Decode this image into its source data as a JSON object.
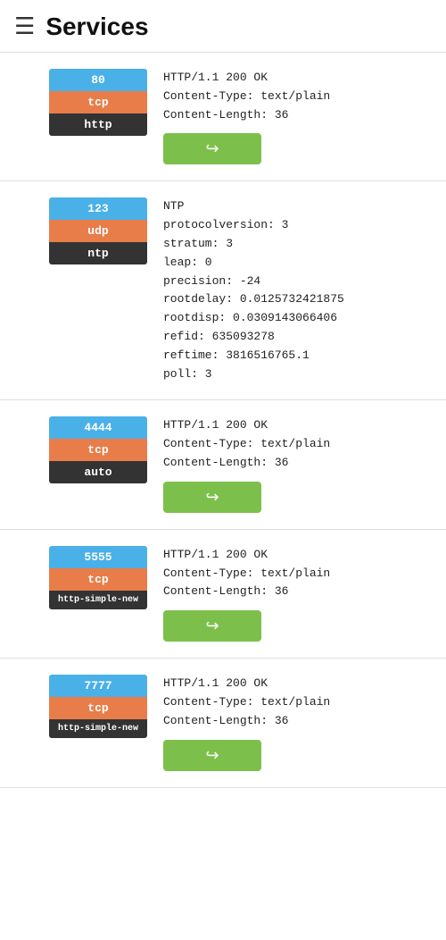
{
  "header": {
    "title": "Services",
    "icon": "☰"
  },
  "services": [
    {
      "id": "svc-80",
      "port": "80",
      "protocol": "tcp",
      "service": "http",
      "info": "HTTP/1.1 200 OK\nContent-Type: text/plain\nContent-Length: 36",
      "hasRedirect": true,
      "redirectLabel": "↪"
    },
    {
      "id": "svc-123",
      "port": "123",
      "protocol": "udp",
      "service": "ntp",
      "info": "NTP\nprotocolversion: 3\nstratum: 3\nleap: 0\nprecision: -24\nrootdelay: 0.0125732421875\nrootdisp: 0.0309143066406\nrefid: 635093278\nreftime: 3816516765.1\npoll: 3",
      "hasRedirect": false,
      "redirectLabel": ""
    },
    {
      "id": "svc-4444",
      "port": "4444",
      "protocol": "tcp",
      "service": "auto",
      "info": "HTTP/1.1 200 OK\nContent-Type: text/plain\nContent-Length: 36",
      "hasRedirect": true,
      "redirectLabel": "↪"
    },
    {
      "id": "svc-5555",
      "port": "5555",
      "protocol": "tcp",
      "service": "http-simple-new",
      "info": "HTTP/1.1 200 OK\nContent-Type: text/plain\nContent-Length: 36",
      "hasRedirect": true,
      "redirectLabel": "↪"
    },
    {
      "id": "svc-7777",
      "port": "7777",
      "protocol": "tcp",
      "service": "http-simple-new",
      "info": "HTTP/1.1 200 OK\nContent-Type: text/plain\nContent-Length: 36",
      "hasRedirect": true,
      "redirectLabel": "↪"
    }
  ]
}
